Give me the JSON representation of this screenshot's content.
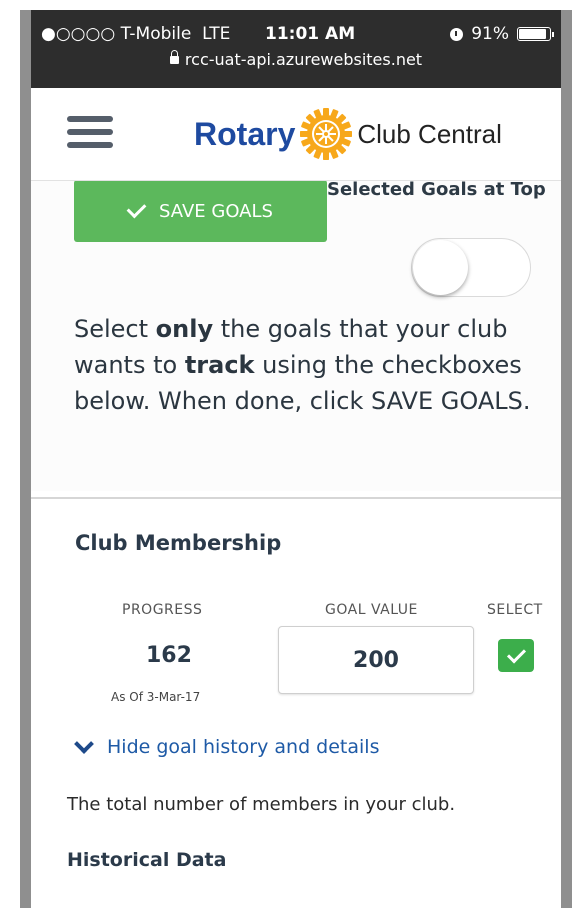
{
  "status_bar": {
    "carrier": "●○○○○ T-Mobile",
    "network": "LTE",
    "time": "11:01 AM",
    "battery": "91%",
    "battery_level": 0.91,
    "url": "rcc-uat-api.azurewebsites.net"
  },
  "header": {
    "brand_name": "Rotary",
    "product_name": "Club Central",
    "brand_color": "#1e4aa0",
    "logo_color": "#f7a81b"
  },
  "top": {
    "save_label": "SAVE GOALS",
    "toggle_label": "Selected Goals at Top",
    "toggle_on": false,
    "instructions": {
      "p1": "Select ",
      "b1": "only",
      "p2": " the goals that your club wants to ",
      "b2": "track",
      "p3": " using the checkboxes below. When done, click SAVE GOALS."
    }
  },
  "goal": {
    "title": "Club Membership",
    "progress_label": "PROGRESS",
    "goal_value_label": "GOAL VALUE",
    "select_label": "SELECT",
    "progress_value": "162",
    "as_of": "As Of 3-Mar-17",
    "goal_value": "200",
    "selected": true,
    "toggle_details": "Hide goal history and details",
    "description": "The total number of members in your club.",
    "historical_heading": "Historical Data"
  },
  "colors": {
    "save_button": "#5cb85c",
    "checkbox": "#3cae4b",
    "link": "#1e5aa6"
  }
}
